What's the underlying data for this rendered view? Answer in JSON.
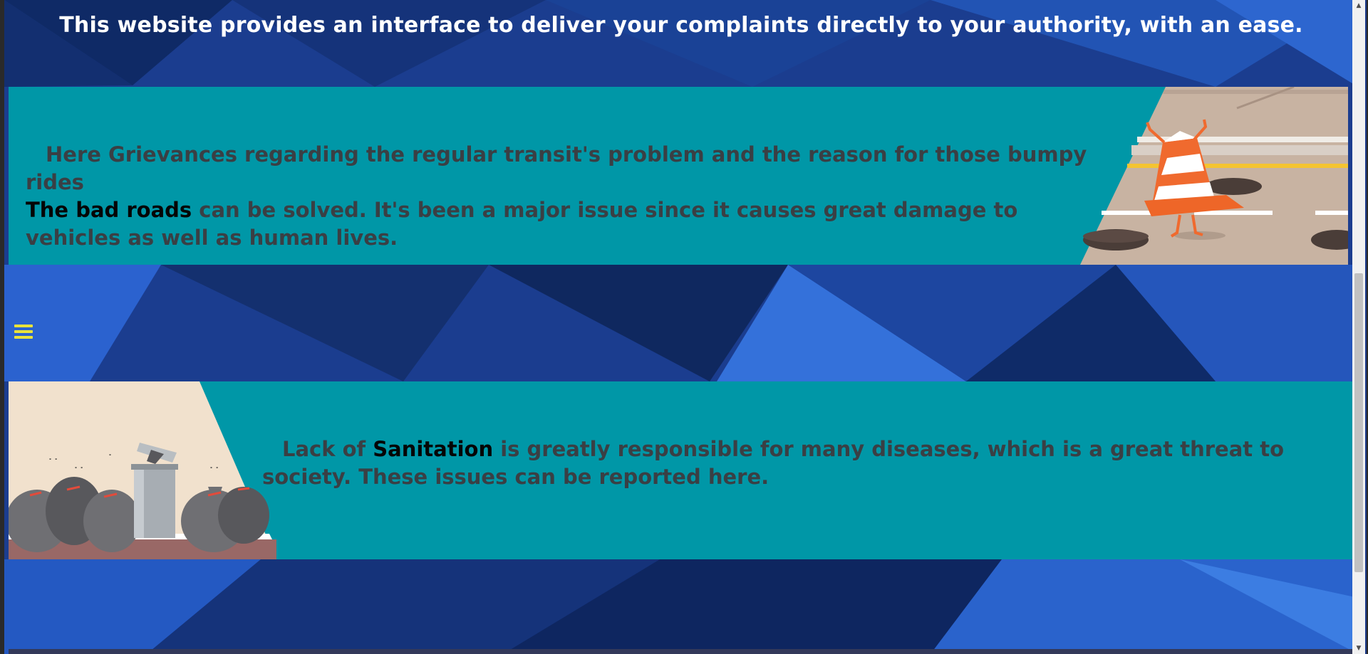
{
  "intro": {
    "text": "This website provides an interface to deliver your complaints directly to your authority, with an ease."
  },
  "road_section": {
    "line1": "Here Grievances regarding the regular transit's problem and the reason for those bumpy rides",
    "highlight": "The bad roads",
    "rest": " can be solved. It's been a major issue since it causes great damage to vehicles as well as human lives."
  },
  "sanitation_section": {
    "prefix": "Lack of ",
    "highlight": "Sanitation",
    "rest": " is greatly responsible for many diseases, which is a great threat to society. These issues can be reported here."
  },
  "icons": {
    "menu": "hamburger-menu-icon",
    "road_illustration": "traffic-cone-pothole-illustration",
    "trash_illustration": "garbage-bags-trash-can-illustration"
  },
  "colors": {
    "band": "#0097a7",
    "text": "#3a3f44",
    "highlight": "#050505",
    "intro_text": "#ffffff",
    "menu_icon": "#e8e23a",
    "background": "#1a3a8a"
  }
}
